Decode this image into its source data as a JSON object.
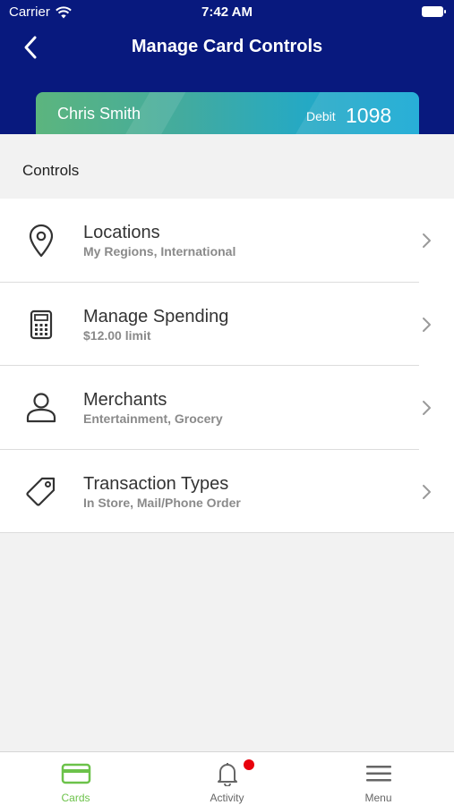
{
  "status_bar": {
    "carrier": "Carrier",
    "time": "7:42 AM"
  },
  "nav": {
    "title": "Manage Card Controls"
  },
  "card": {
    "name": "Chris Smith",
    "type": "Debit",
    "number": "1098"
  },
  "controls": {
    "header": "Controls",
    "items": [
      {
        "title": "Locations",
        "subtitle": "My Regions, International",
        "icon": "location-pin-icon"
      },
      {
        "title": "Manage Spending",
        "subtitle": "$12.00 limit",
        "icon": "calculator-icon"
      },
      {
        "title": "Merchants",
        "subtitle": "Entertainment, Grocery",
        "icon": "person-icon"
      },
      {
        "title": "Transaction Types",
        "subtitle": "In Store, Mail/Phone Order",
        "icon": "tag-icon"
      }
    ]
  },
  "tabbar": {
    "tabs": [
      {
        "label": "Cards",
        "icon": "card-icon",
        "active": true
      },
      {
        "label": "Activity",
        "icon": "bell-icon",
        "active": false
      },
      {
        "label": "Menu",
        "icon": "hamburger-icon",
        "active": false
      }
    ]
  },
  "colors": {
    "header_bg": "#08197e",
    "accent_green": "#6cc24a",
    "badge_red": "#e8000c",
    "card_gradient_start": "#5cb57e",
    "card_gradient_end": "#10a6d4"
  }
}
